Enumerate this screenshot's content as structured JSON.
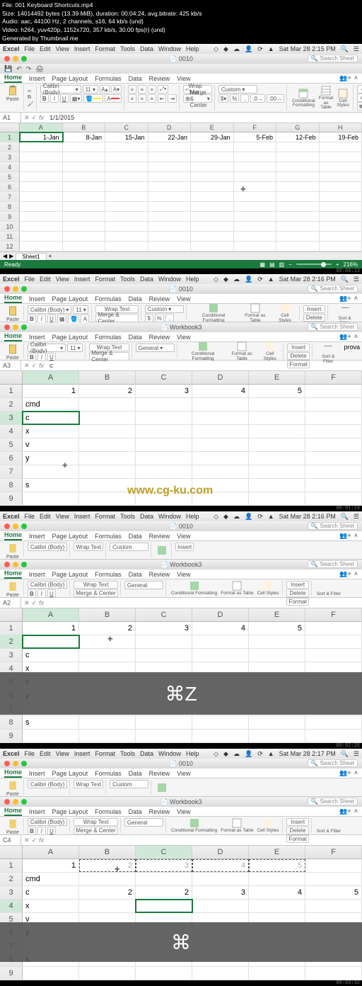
{
  "terminal": {
    "l1": "File: 001 Keyboard Shortcuts.mp4",
    "l2": "Size: 14014492 bytes (13.39 MiB), duration: 00:04:24, avg.bitrate: 425 kb/s",
    "l3": "Audio: aac, 44100 Hz, 2 channels, s16, 64 kb/s (und)",
    "l4": "Video: h264, yuv420p, 1152x720, 357 kb/s, 30.00 fps(r) (und)",
    "l5": "Generated by Thumbnail me"
  },
  "menubar": {
    "items": [
      "Excel",
      "File",
      "Edit",
      "View",
      "Insert",
      "Format",
      "Tools",
      "Data",
      "Window",
      "Help"
    ]
  },
  "datetime": {
    "a": "Sat Mar 28  2:15 PM",
    "b": "Sat Mar 28  2:16 PM",
    "c": "Sat Mar 28  2:16 PM",
    "d": "Sat Mar 28  2:17 PM"
  },
  "timecode": {
    "a": "00:00:13",
    "b": "00:01:19",
    "c": "00:02:26",
    "d": "00:03:32"
  },
  "title": {
    "a": "0010",
    "b": "0010",
    "c": "0010",
    "d": "0010"
  },
  "workbook3": "Workbook3",
  "search_placeholder": "Search Sheet",
  "tabs": [
    "Home",
    "Insert",
    "Page Layout",
    "Formulas",
    "Data",
    "Review",
    "View"
  ],
  "paste_label": "Paste",
  "font": {
    "name": "Calibri (Body)",
    "size": "11"
  },
  "wrap_text": "Wrap Text",
  "merge": "Merge & Center",
  "numfmt": {
    "custom": "Custom",
    "general": "General"
  },
  "cond_fmt": "Conditional\nFormatting",
  "as_table": "Format as\nTable",
  "cell_styles": "Cell\nStyles",
  "insert": "Insert",
  "delete": "Delete",
  "format": "Format",
  "sort_filter": "Sort &\nFilter",
  "refA": "A1",
  "refB": "A3",
  "refC": "A2",
  "refD": "C4",
  "fxA": "1/1/2015",
  "fxB": "c",
  "fxC": "",
  "fxD": "",
  "colsA": [
    "A",
    "B",
    "C",
    "D",
    "E",
    "F",
    "G",
    "H"
  ],
  "rowA1": [
    "1-Jan",
    "8-Jan",
    "15-Jan",
    "22-Jan",
    "29-Jan",
    "5-Feb",
    "12-Feb",
    "19-Feb"
  ],
  "sheet1": "Sheet1",
  "ready": "Ready",
  "zoomA": "216%",
  "cols5": [
    "A",
    "B",
    "C",
    "D",
    "E",
    "F"
  ],
  "row_nums": [
    "1",
    "2",
    "3",
    "4",
    "5"
  ],
  "cmd_list": {
    "r2": "cmd",
    "r3": "c",
    "r4": "x",
    "r5": "v",
    "r6": "y",
    "r7": "",
    "r8": "s"
  },
  "row2_nums": [
    "2",
    "2",
    "3",
    "4",
    "5"
  ],
  "watermark": "www.cg-ku.com",
  "cmdZ": "⌘Z",
  "cmdSym": "⌘"
}
